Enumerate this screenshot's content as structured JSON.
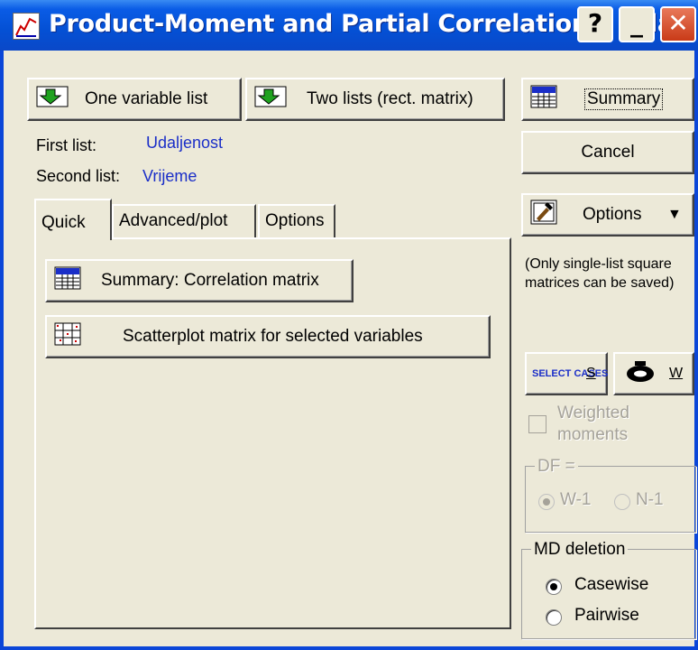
{
  "window": {
    "title": "Product-Moment and Partial Correlations: Udal",
    "help_label": "?",
    "minimize_label": "_",
    "close_label": "✕"
  },
  "toolbar": {
    "one_list_label": "One variable list",
    "two_lists_label": "Two lists (rect. matrix)",
    "summary_label": "Summary",
    "cancel_label": "Cancel",
    "options_label": "Options",
    "options_arrow": "▼"
  },
  "lists": {
    "first_label": "First list:",
    "first_value": "Udaljenost",
    "second_label": "Second list:",
    "second_value": "Vrijeme"
  },
  "tabs": [
    {
      "label": "Quick",
      "active": true
    },
    {
      "label": "Advanced/plot",
      "active": false
    },
    {
      "label": "Options",
      "active": false
    }
  ],
  "quick": {
    "summary_corr_label": "Summary:  Correlation matrix",
    "scatterplot_label": "Scatterplot matrix for selected variables"
  },
  "side": {
    "note": "(Only single-list square matrices can be saved)",
    "select_cases_icon_text": "SELECT CASES",
    "select_cases_key": "S",
    "weight_key": "W",
    "weighted_label": "Weighted moments",
    "df_legend": "DF =",
    "df_options": [
      "W-1",
      "N-1"
    ],
    "md_legend": "MD deletion",
    "md_options": [
      "Casewise",
      "Pairwise"
    ],
    "md_selected": "Casewise"
  },
  "colors": {
    "face": "#ece9d8",
    "titlebar": "#0a5ce6",
    "list_value": "#1a2ec8"
  }
}
